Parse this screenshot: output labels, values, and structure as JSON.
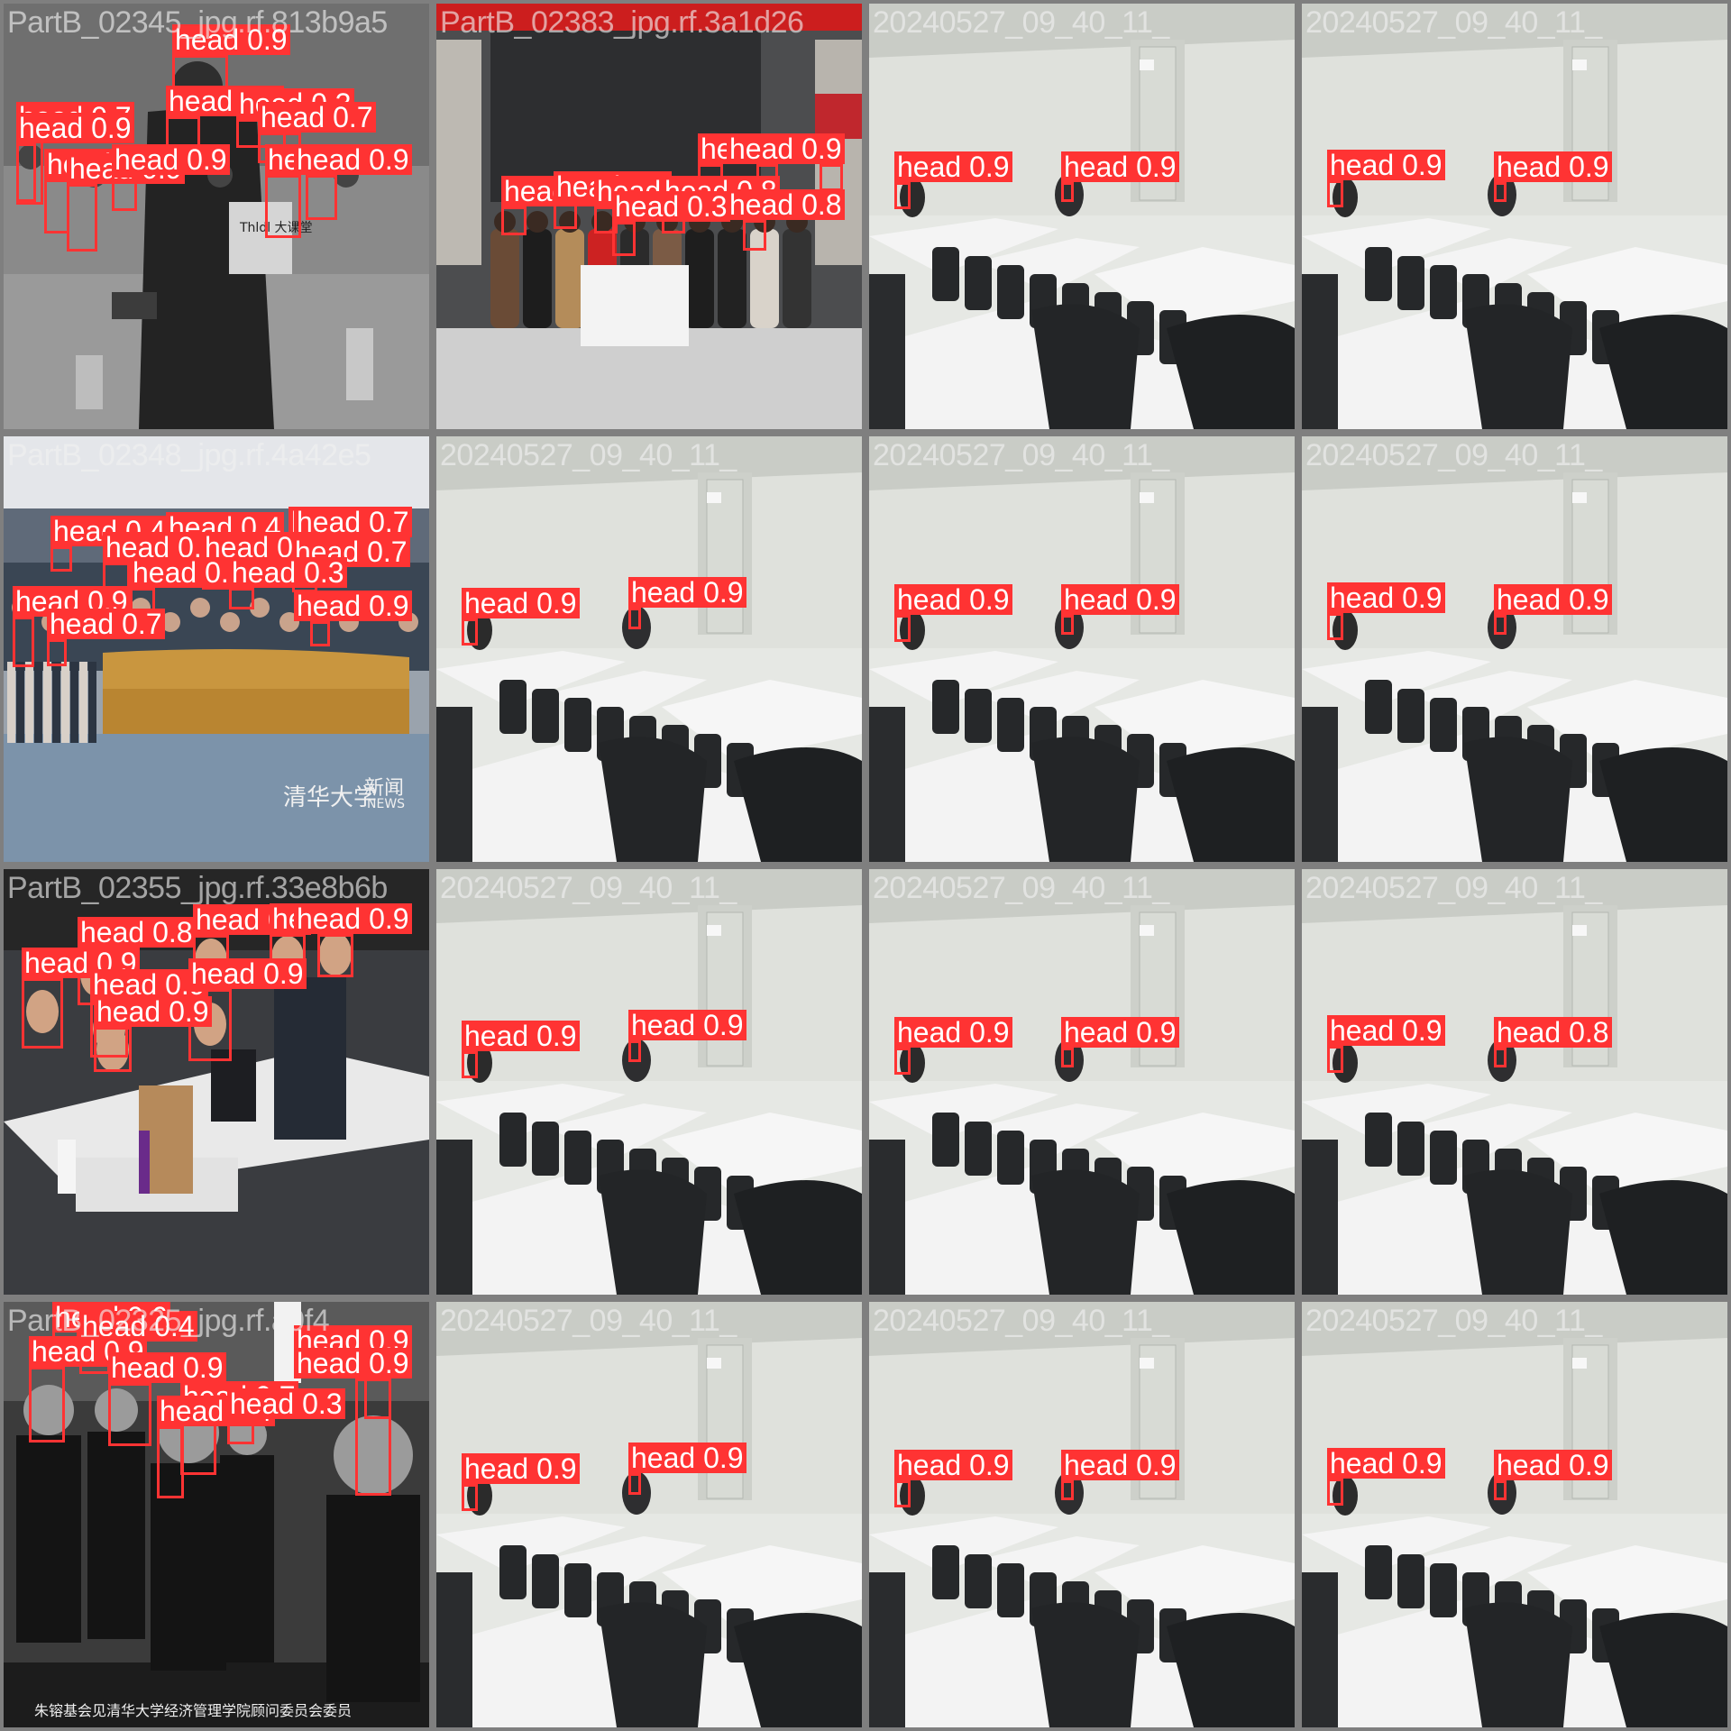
{
  "mosaic": {
    "tiles": [
      {
        "filename": "PartB_02345_jpg.rf.813b9a5",
        "scene": "grayscale-lecture",
        "overlay_text": [
          {
            "role": "banner-sign",
            "text": "Thldl 大课堂"
          }
        ],
        "detections": [
          {
            "label": "head",
            "conf": "0.9"
          },
          {
            "label": "head",
            "conf": "0.7"
          },
          {
            "label": "head",
            "conf": "0.7"
          },
          {
            "label": "head",
            "conf": "0.9"
          },
          {
            "label": "head",
            "conf": "0.3"
          },
          {
            "label": "head",
            "conf": "0.7"
          },
          {
            "label": "head",
            "conf": "0.9"
          },
          {
            "label": "head",
            "conf": "0.9"
          },
          {
            "label": "head",
            "conf": "0.8"
          },
          {
            "label": "head",
            "conf": "0.9"
          },
          {
            "label": "head",
            "conf": "0.9"
          }
        ]
      },
      {
        "filename": "PartB_02383_jpg.rf.3a1d26",
        "scene": "group-photo",
        "overlay_text": [],
        "detections": [
          {
            "label": "head",
            "conf": "0.8"
          },
          {
            "label": "head",
            "conf": "0.8"
          },
          {
            "label": "head",
            "conf": "0.9"
          },
          {
            "label": "head",
            "conf": "0.7"
          },
          {
            "label": "head",
            "conf": "0.7"
          },
          {
            "label": "head",
            "conf": "0.7"
          },
          {
            "label": "head",
            "conf": "0.8"
          },
          {
            "label": "head",
            "conf": "0.3"
          },
          {
            "label": "head",
            "conf": "0.8"
          }
        ]
      },
      {
        "filename": "20240527_09_40_11_",
        "scene": "classroom",
        "overlay_text": [],
        "detections": [
          {
            "label": "head",
            "conf": "0.9"
          },
          {
            "label": "head",
            "conf": "0.9"
          }
        ]
      },
      {
        "filename": "20240527_09_40_11_",
        "scene": "classroom",
        "overlay_text": [],
        "detections": [
          {
            "label": "head",
            "conf": "0.9"
          },
          {
            "label": "head",
            "conf": "0.9"
          }
        ]
      },
      {
        "filename": "PartB_02348_jpg.rf.4a42e5",
        "scene": "conference",
        "overlay_text": [
          {
            "role": "watermark",
            "text": "清华大学"
          },
          {
            "role": "watermark",
            "text": "新闻"
          },
          {
            "role": "watermark",
            "text": "NEWS"
          }
        ],
        "detections": [
          {
            "label": "head",
            "conf": "0.4"
          },
          {
            "label": "head",
            "conf": "0.4"
          },
          {
            "label": "head",
            "conf": "0.6"
          },
          {
            "label": "head",
            "conf": "0.7"
          },
          {
            "label": "head",
            "conf": "0.3"
          },
          {
            "label": "head",
            "conf": "0.3"
          },
          {
            "label": "head",
            "conf": "0.7"
          },
          {
            "label": "head",
            "conf": "0.3"
          },
          {
            "label": "head",
            "conf": "0.3"
          },
          {
            "label": "head",
            "conf": "0.9"
          },
          {
            "label": "head",
            "conf": "0.9"
          },
          {
            "label": "head",
            "conf": "0.7"
          }
        ]
      },
      {
        "filename": "20240527_09_40_11_",
        "scene": "classroom",
        "overlay_text": [],
        "detections": [
          {
            "label": "head",
            "conf": "0.9"
          },
          {
            "label": "head",
            "conf": "0.9"
          }
        ]
      },
      {
        "filename": "20240527_09_40_11_",
        "scene": "classroom",
        "overlay_text": [],
        "detections": [
          {
            "label": "head",
            "conf": "0.9"
          },
          {
            "label": "head",
            "conf": "0.9"
          }
        ]
      },
      {
        "filename": "20240527_09_40_11_",
        "scene": "classroom",
        "overlay_text": [],
        "detections": [
          {
            "label": "head",
            "conf": "0.9"
          },
          {
            "label": "head",
            "conf": "0.9"
          }
        ]
      },
      {
        "filename": "PartB_02355_jpg.rf.33e8b6b",
        "scene": "meeting-color",
        "overlay_text": [],
        "detections": [
          {
            "label": "head",
            "conf": "0.8"
          },
          {
            "label": "head",
            "conf": "0.9"
          },
          {
            "label": "head",
            "conf": "0.9"
          },
          {
            "label": "head",
            "conf": "0.9"
          },
          {
            "label": "head",
            "conf": "0.9"
          },
          {
            "label": "head",
            "conf": "0.9"
          },
          {
            "label": "head",
            "conf": "0.9"
          },
          {
            "label": "head",
            "conf": "0.9"
          }
        ]
      },
      {
        "filename": "20240527_09_40_11_",
        "scene": "classroom",
        "overlay_text": [],
        "detections": [
          {
            "label": "head",
            "conf": "0.9"
          },
          {
            "label": "head",
            "conf": "0.9"
          }
        ]
      },
      {
        "filename": "20240527_09_40_11_",
        "scene": "classroom",
        "overlay_text": [],
        "detections": [
          {
            "label": "head",
            "conf": "0.9"
          },
          {
            "label": "head",
            "conf": "0.9"
          }
        ]
      },
      {
        "filename": "20240527_09_40_11_",
        "scene": "classroom",
        "overlay_text": [],
        "detections": [
          {
            "label": "head",
            "conf": "0.9"
          },
          {
            "label": "head",
            "conf": "0.8"
          }
        ]
      },
      {
        "filename": "PartB_02325_jpg.rf.a9f4",
        "scene": "grayscale-portrait",
        "overlay_text": [
          {
            "role": "caption",
            "text": "朱镕基会见清华大学经济管理学院顾问委员会委员"
          }
        ],
        "detections": [
          {
            "label": "head",
            "conf": "0.6"
          },
          {
            "label": "head",
            "conf": "0.4"
          },
          {
            "label": "head",
            "conf": "0.9"
          },
          {
            "label": "head",
            "conf": "0.9"
          },
          {
            "label": "head",
            "conf": "0.7"
          },
          {
            "label": "head",
            "conf": "0.4"
          },
          {
            "label": "head",
            "conf": "0.3"
          },
          {
            "label": "head",
            "conf": "0.9"
          },
          {
            "label": "head",
            "conf": "0.9"
          }
        ]
      },
      {
        "filename": "20240527_09_40_11_",
        "scene": "classroom",
        "overlay_text": [],
        "detections": [
          {
            "label": "head",
            "conf": "0.9"
          },
          {
            "label": "head",
            "conf": "0.9"
          }
        ]
      },
      {
        "filename": "20240527_09_40_11_",
        "scene": "classroom",
        "overlay_text": [],
        "detections": [
          {
            "label": "head",
            "conf": "0.9"
          },
          {
            "label": "head",
            "conf": "0.9"
          }
        ]
      },
      {
        "filename": "20240527_09_40_11_",
        "scene": "classroom",
        "overlay_text": [],
        "detections": [
          {
            "label": "head",
            "conf": "0.9"
          },
          {
            "label": "head",
            "conf": "0.9"
          }
        ]
      }
    ]
  },
  "colors": {
    "box": "#ff3333",
    "label_bg": "#ff3333",
    "label_text": "#ffffff",
    "frame": "#7f7f7f"
  }
}
